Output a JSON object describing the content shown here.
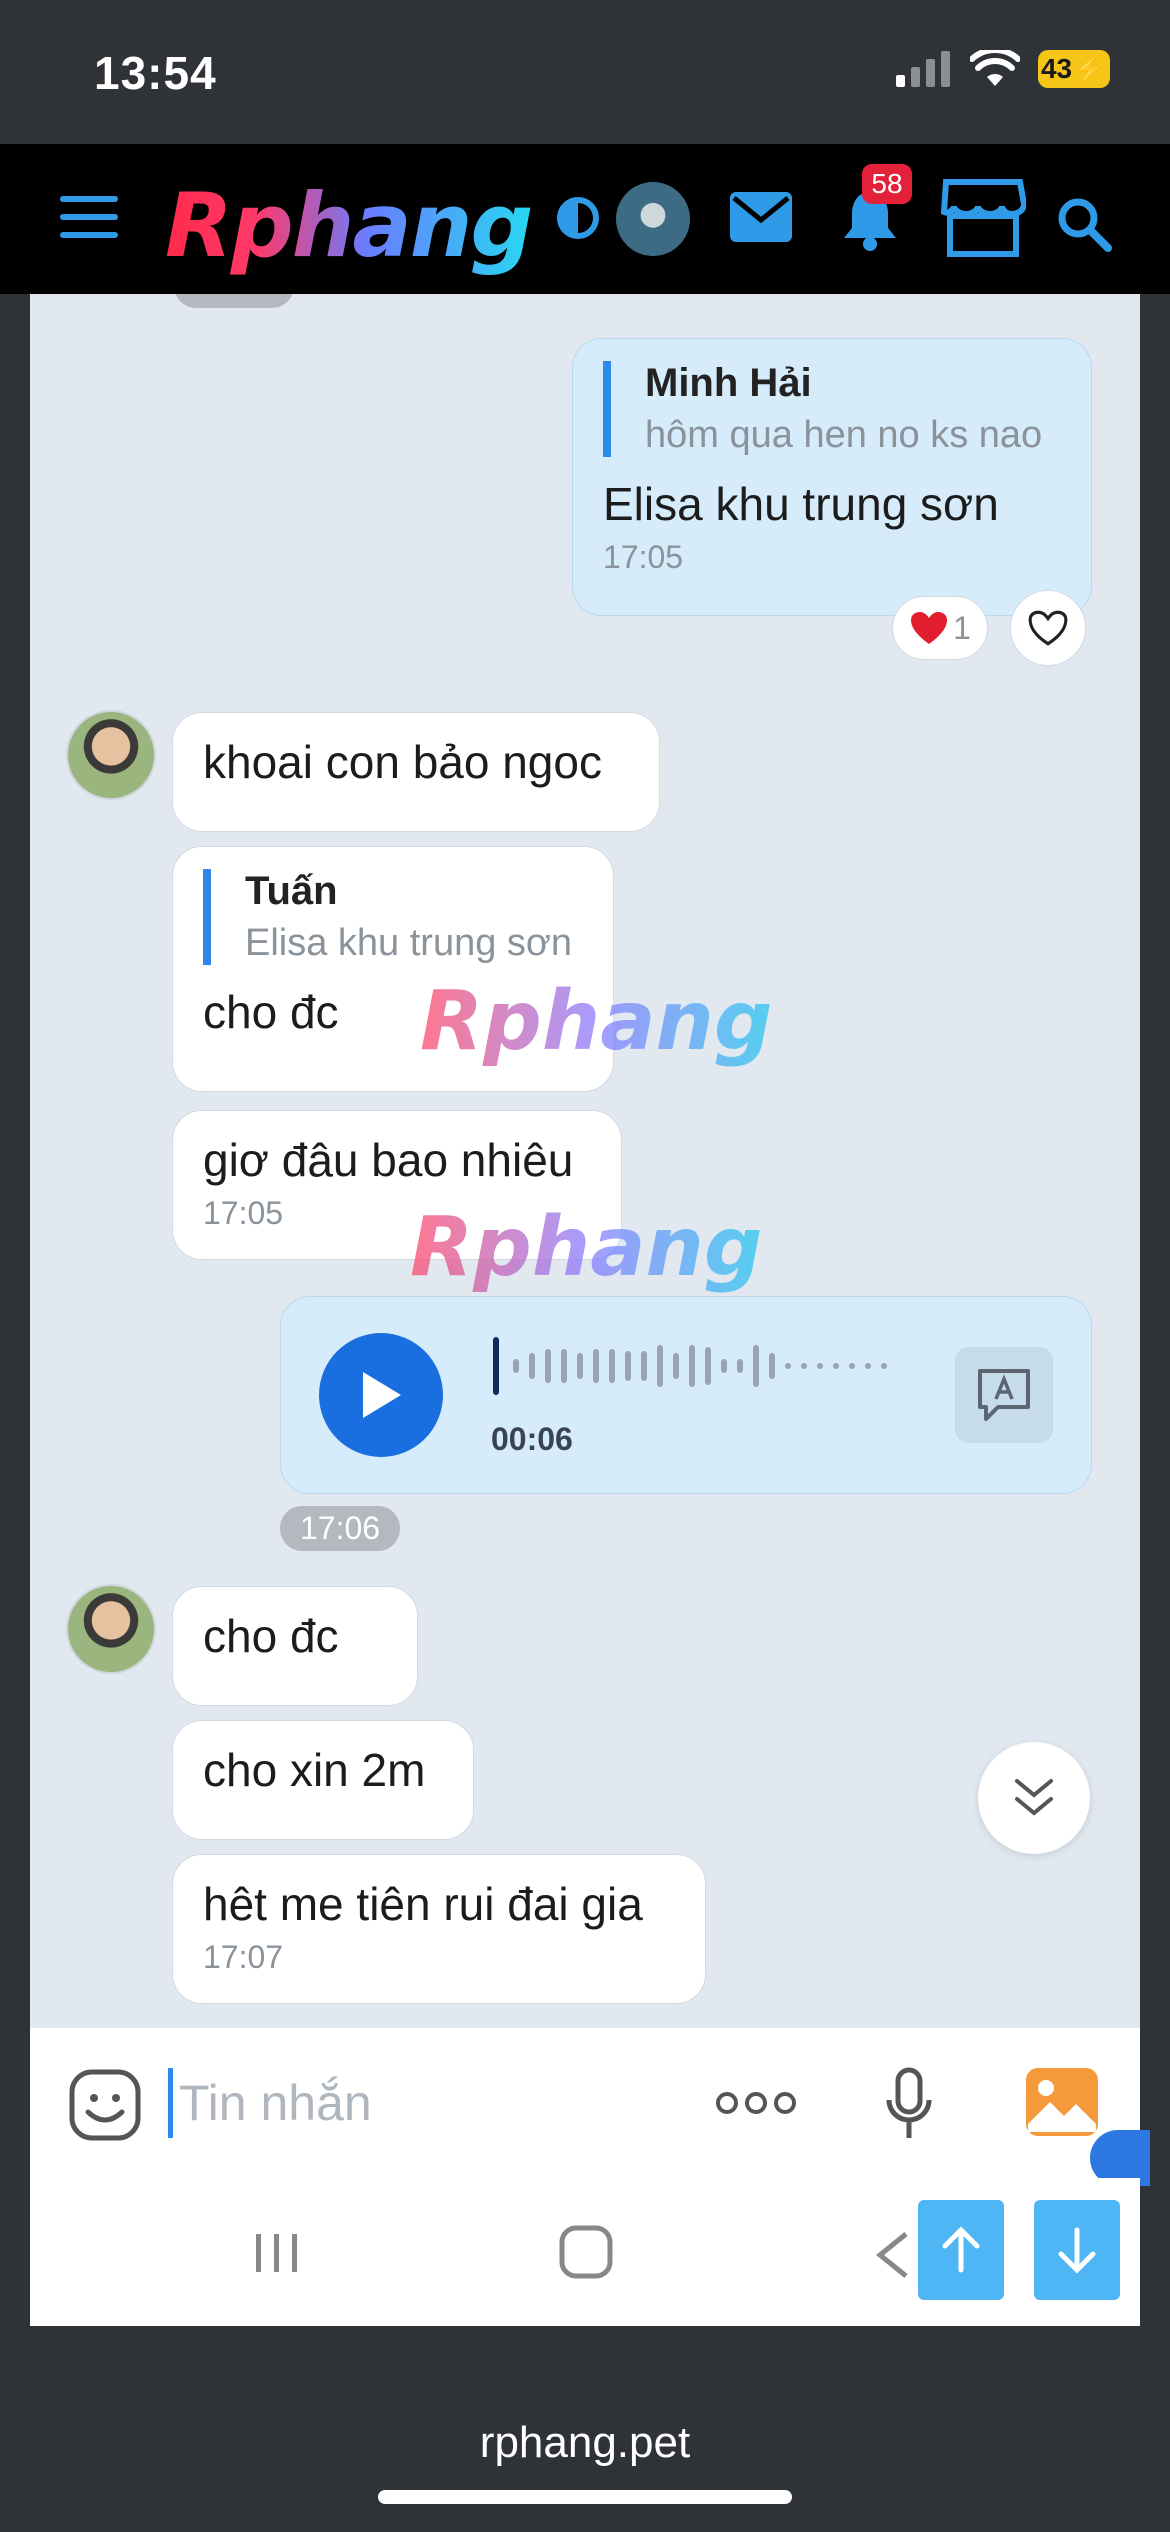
{
  "status_bar": {
    "time": "13:54",
    "battery": "43"
  },
  "header": {
    "logo": "Rphang",
    "notification_count": "58"
  },
  "watermark": "Rphang",
  "messages": {
    "m1": {
      "quote_name": "Minh Hải",
      "quote_text": "hôm qua hen no ks nao",
      "text": "Elisa khu trung sơn",
      "time": "17:05",
      "reaction_count": "1"
    },
    "m2": {
      "text": "khoai con bảo ngoc"
    },
    "m3": {
      "quote_name": "Tuấn",
      "quote_text": "Elisa khu trung sơn",
      "text": "cho đc"
    },
    "m4": {
      "text": "giơ đâu bao nhiêu",
      "time": "17:05"
    },
    "voice": {
      "duration": "00:06"
    },
    "time_pill": "17:06",
    "m5": {
      "text": "cho đc"
    },
    "m6": {
      "text": "cho xin 2m"
    },
    "m7": {
      "text": "hêt me tiên rui đai gia",
      "time": "17:07"
    }
  },
  "composer": {
    "placeholder": "Tin nhắn"
  },
  "browser": {
    "url": "rphang.pet"
  }
}
